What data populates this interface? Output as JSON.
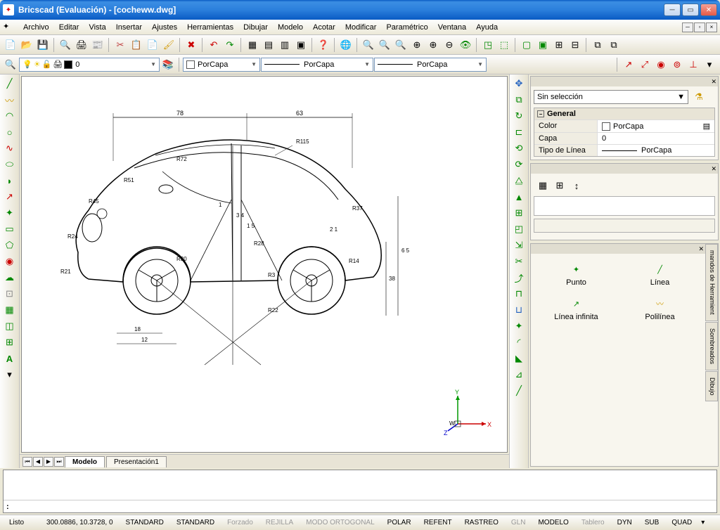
{
  "window": {
    "title": "Bricscad (Evaluación) - [cocheww.dwg]"
  },
  "menu": [
    "Archivo",
    "Editar",
    "Vista",
    "Insertar",
    "Ajustes",
    "Herramientas",
    "Dibujar",
    "Modelo",
    "Acotar",
    "Modificar",
    "Paramétrico",
    "Ventana",
    "Ayuda"
  ],
  "layer_toolbar": {
    "layer": "0",
    "color": "PorCapa",
    "linetype": "PorCapa",
    "lineweight": "PorCapa"
  },
  "tabs": {
    "model": "Modelo",
    "layout1": "Presentación1"
  },
  "properties": {
    "selection": "Sin selección",
    "group": "General",
    "rows": [
      {
        "key": "Color",
        "value": "PorCapa"
      },
      {
        "key": "Capa",
        "value": "0"
      },
      {
        "key": "Tipo de Línea",
        "value": "PorCapa"
      }
    ]
  },
  "tool_palette": {
    "items": [
      {
        "name": "Punto"
      },
      {
        "name": "Línea"
      },
      {
        "name": "Línea infinita"
      },
      {
        "name": "Polilínea"
      }
    ],
    "side_tabs": [
      "mandos de Herramient",
      "Sombreados",
      "Dibujo"
    ]
  },
  "dimensions": {
    "top1": "78",
    "top2": "63",
    "r115": "R115",
    "r72": "R72",
    "r51": "R51",
    "r45": "R45",
    "r24": "R24",
    "r21": "R21",
    "r30": "R30",
    "r28": "R28",
    "r37": "R37",
    "r14": "R14",
    "r22": "R22",
    "r3": "R3",
    "d1": "1",
    "d34": "3 4",
    "d15": "1 5",
    "d18": "18",
    "d12": "12",
    "d65": "6 5",
    "d38": "38",
    "d21": "2 1"
  },
  "ucs": {
    "x": "X",
    "y": "Y",
    "z": "Z",
    "w": "W"
  },
  "command": {
    "prompt": ":"
  },
  "status": {
    "ready": "Listo",
    "coords": "300.0886, 10.3728, 0",
    "std1": "STANDARD",
    "std2": "STANDARD",
    "forzado": "Forzado",
    "rejilla": "REJILLA",
    "ortho": "MODO ORTOGONAL",
    "polar": "POLAR",
    "refent": "REFENT",
    "rastreo": "RASTREO",
    "gln": "GLN",
    "modelo": "MODELO",
    "tablero": "Tablero",
    "dyn": "DYN",
    "sub": "SUB",
    "quad": "QUAD"
  }
}
